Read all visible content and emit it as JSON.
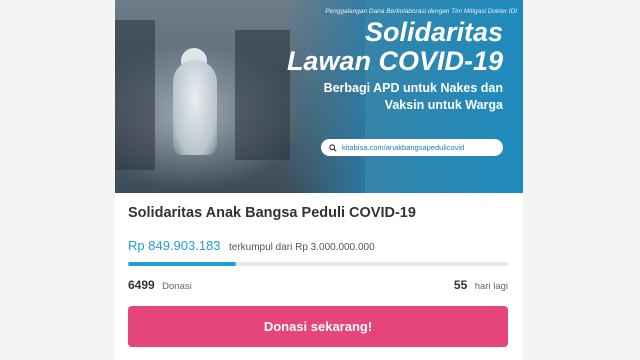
{
  "banner": {
    "kicker": "Penggalangan Dana Berkolaborasi dengan Tim Mitigasi Dokter IDI",
    "title_line1": "Solidaritas",
    "title_line2": "Lawan COVID-19",
    "subtitle_line1": "Berbagi APD untuk Nakes dan",
    "subtitle_line2": "Vaksin untuk Warga",
    "url": "kitabisa.com/anakbangsapedulicovid"
  },
  "campaign": {
    "title": "Solidaritas Anak Bangsa Peduli COVID-19",
    "amount": "Rp 849.903.183",
    "raised_text": "terkumpul dari Rp 3.000.000.000",
    "progress_fraction": 0.283,
    "donor_count": "6499",
    "donor_label": "Donasi",
    "days_left": "55",
    "days_label": "hari lagi",
    "cta_label": "Donasi sekarang!"
  },
  "colors": {
    "accent": "#1fa0d8",
    "cta": "#e5457a"
  }
}
